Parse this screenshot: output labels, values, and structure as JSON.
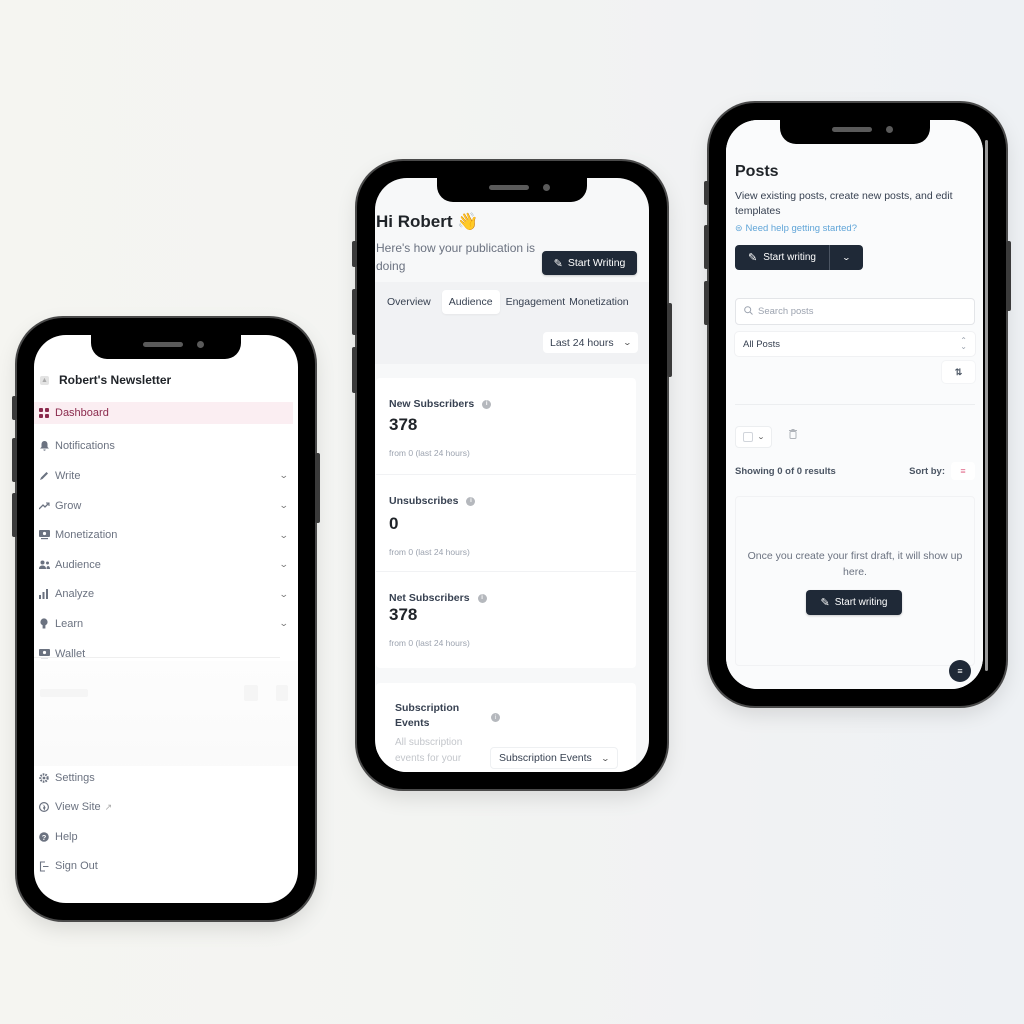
{
  "colors": {
    "background": "#f3f4f2",
    "phone_frame": "#000000",
    "accent_active": "#8b2a4d",
    "active_bg": "#fbeef2",
    "dark_button": "#1f2937",
    "link": "#60a5d8"
  },
  "sidebar_screen": {
    "publication_name": "Robert's Newsletter",
    "logo_icon": "publication-logo-icon",
    "nav_items": [
      {
        "label": "Dashboard",
        "icon": "grid-icon",
        "active": true,
        "expandable": false
      },
      {
        "label": "Notifications",
        "icon": "bell-icon",
        "active": false,
        "expandable": false
      },
      {
        "label": "Write",
        "icon": "pencil-icon",
        "active": false,
        "expandable": true
      },
      {
        "label": "Grow",
        "icon": "trend-up-icon",
        "active": false,
        "expandable": true
      },
      {
        "label": "Monetization",
        "icon": "money-icon",
        "active": false,
        "expandable": true
      },
      {
        "label": "Audience",
        "icon": "users-icon",
        "active": false,
        "expandable": true
      },
      {
        "label": "Analyze",
        "icon": "bar-chart-icon",
        "active": false,
        "expandable": true
      },
      {
        "label": "Learn",
        "icon": "lightbulb-icon",
        "active": false,
        "expandable": true
      },
      {
        "label": "Wallet",
        "icon": "wallet-icon",
        "active": false,
        "expandable": false
      }
    ],
    "bottom_items": [
      {
        "label": "Settings",
        "icon": "gear-icon"
      },
      {
        "label": "View Site",
        "icon": "globe-icon",
        "external": true
      },
      {
        "label": "Help",
        "icon": "question-icon"
      },
      {
        "label": "Sign Out",
        "icon": "sign-out-icon"
      }
    ]
  },
  "dashboard_screen": {
    "greeting": "Hi Robert",
    "greeting_emoji": "👋",
    "subtitle": "Here's how your publication is doing",
    "start_writing_label": "Start Writing",
    "tabs": [
      {
        "label": "Overview",
        "active": false
      },
      {
        "label": "Audience",
        "active": true
      },
      {
        "label": "Engagement",
        "active": false
      },
      {
        "label": "Monetization",
        "active": false
      }
    ],
    "range_select": "Last 24 hours",
    "stats": [
      {
        "title": "New Subscribers",
        "value": "378",
        "sub": "from 0 (last 24 hours)"
      },
      {
        "title": "Unsubscribes",
        "value": "0",
        "sub": "from 0 (last 24 hours)"
      },
      {
        "title": "Net Subscribers",
        "value": "378",
        "sub": "from 0 (last 24 hours)"
      }
    ],
    "events": {
      "title": "Subscription Events",
      "description": "All subscription events for your",
      "select": "Subscription Events"
    }
  },
  "posts_screen": {
    "title": "Posts",
    "description": "View existing posts, create new posts, and edit templates",
    "help_link": "Need help getting started?",
    "start_writing_label": "Start writing",
    "search_placeholder": "Search posts",
    "filter_select": "All Posts",
    "results_text": "Showing 0 of 0 results",
    "sort_label": "Sort by:",
    "empty_message": "Once you create your first draft, it will show up here.",
    "empty_button_label": "Start writing"
  }
}
